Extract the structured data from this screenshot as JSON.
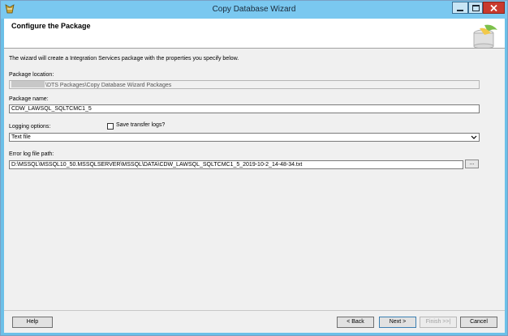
{
  "window": {
    "title": "Copy Database Wizard",
    "controls": {
      "minimize": "minimize",
      "maximize": "maximize",
      "close": "close"
    }
  },
  "header": {
    "title": "Configure the Package",
    "graphic_icon": "database-package-icon"
  },
  "intro_text": "The wizard will create a Integration Services package with the properties you specify below.",
  "package_location": {
    "label": "Package location:",
    "value": "\\DTS Packages\\Copy Database Wizard Packages"
  },
  "package_name": {
    "label": "Package name:",
    "value": "CDW_LAWSQL_SQLTCMC1_5"
  },
  "logging": {
    "label": "Logging options:",
    "save_transfer_logs_label": "Save transfer logs?",
    "save_transfer_logs_checked": false,
    "selected": "Text file"
  },
  "error_log": {
    "label": "Error log file path:",
    "value": "D:\\MSSQL\\MSSQL10_50.MSSQLSERVER\\MSSQL\\DATA\\CDW_LAWSQL_SQLTCMC1_5_2019-10-2_14-48-34.txt",
    "browse_label": "..."
  },
  "buttons": {
    "help": "Help",
    "back": "< Back",
    "next": "Next >",
    "finish": "Finish >>|",
    "cancel": "Cancel"
  },
  "colors": {
    "titlebar": "#7ac8f0",
    "close_button": "#c93a2e",
    "dialog_bg": "#f0f0f0"
  }
}
